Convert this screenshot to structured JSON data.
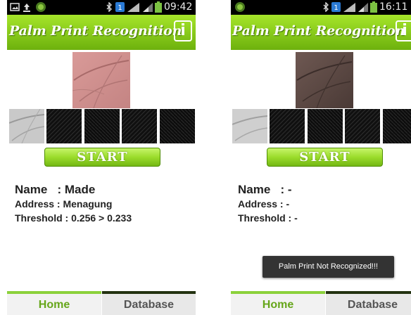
{
  "screens": [
    {
      "status_time": "09:42",
      "title": "Palm Print Recognition",
      "start_label": "START",
      "name_line": "Name   : Made",
      "address_line": "Address : Menagung",
      "threshold_line": "Threshold : 0.256 > 0.233",
      "toast": "",
      "tabs": [
        "Home",
        "Database"
      ]
    },
    {
      "status_time": "16:11",
      "title": "Palm Print Recognition",
      "start_label": "START",
      "name_line": "Name   : -",
      "address_line": "Address : -",
      "threshold_line": "Threshold : -",
      "toast": "Palm Print Not Recognized!!!",
      "tabs": [
        "Home",
        "Database"
      ]
    }
  ],
  "colors": {
    "titlebar_top": "#a6e52a",
    "titlebar_bottom": "#6db10d",
    "tab_active": "#66a61a",
    "tab_inactive_text": "#555555"
  }
}
